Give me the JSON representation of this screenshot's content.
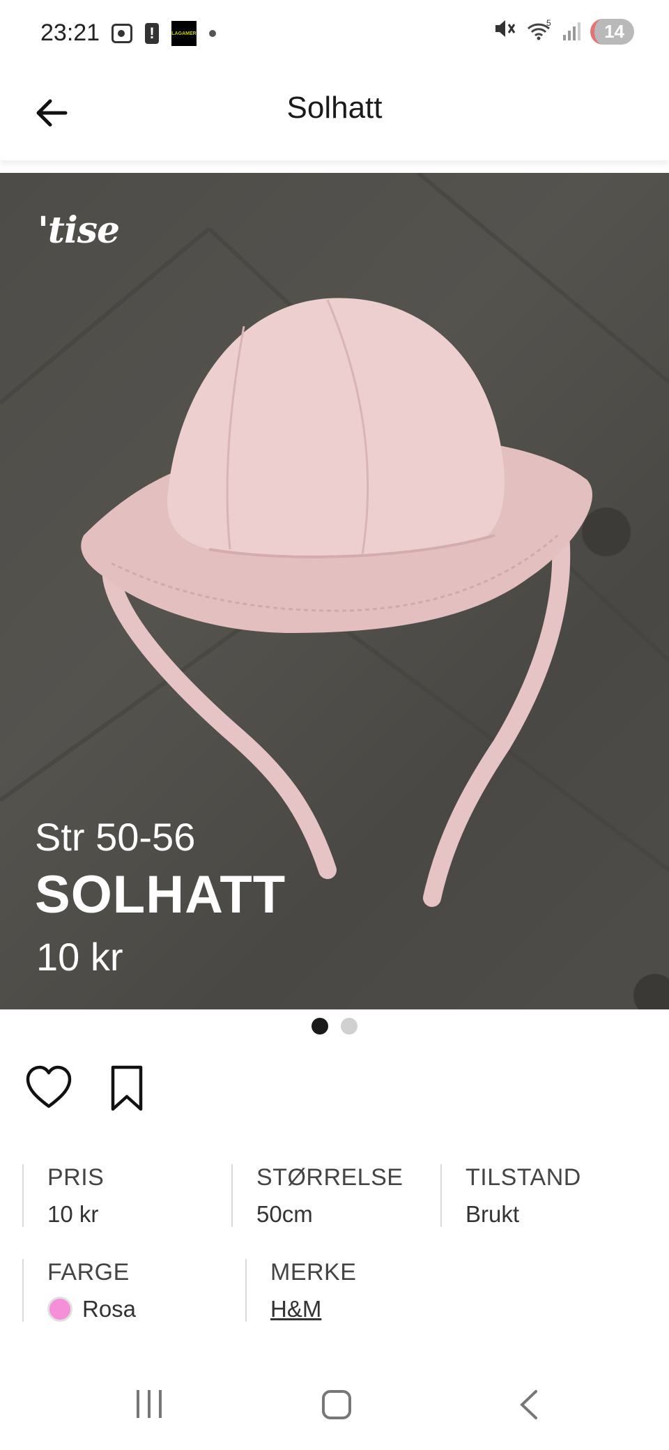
{
  "status_bar": {
    "time": "23:21",
    "notification_count": "14",
    "app_icon_text": "LAGAMER"
  },
  "header": {
    "title": "Solhatt"
  },
  "photo": {
    "watermark": "'tise",
    "size_text": "Str 50-56",
    "name_text": "SOLHATT",
    "price_text": "10 kr",
    "page_count": 2,
    "active_page": 1
  },
  "details": {
    "price_label": "PRIS",
    "price_value": "10 kr",
    "size_label": "STØRRELSE",
    "size_value": "50cm",
    "condition_label": "TILSTAND",
    "condition_value": "Brukt",
    "color_label": "FARGE",
    "color_value": "Rosa",
    "color_hex": "#f58fd8",
    "brand_label": "MERKE",
    "brand_value": "H&M"
  },
  "colors": {
    "accent": "#1a1a1a",
    "hat": "#ecc9c8",
    "background": "#4f4d49"
  },
  "icons": [
    "back-arrow-icon",
    "heart-icon",
    "bookmark-icon"
  ]
}
